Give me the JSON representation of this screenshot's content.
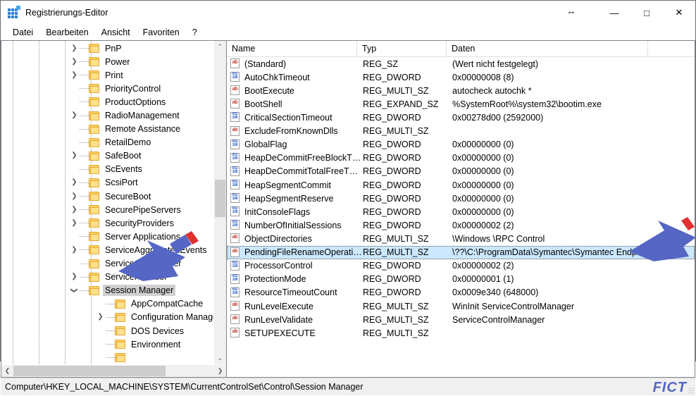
{
  "window": {
    "title": "Registrierungs-Editor",
    "icon": "registry-editor-icon",
    "controls": {
      "minimize": "—",
      "maximize": "□",
      "close": "✕",
      "resize_cursor": "↔"
    }
  },
  "menu": {
    "items": [
      "Datei",
      "Bearbeiten",
      "Ansicht",
      "Favoriten",
      "?"
    ]
  },
  "tree": {
    "selected": "Session Manager",
    "items": [
      {
        "label": "PnP",
        "depth": 3,
        "expander": "collapsed"
      },
      {
        "label": "Power",
        "depth": 3,
        "expander": "collapsed"
      },
      {
        "label": "Print",
        "depth": 3,
        "expander": "collapsed"
      },
      {
        "label": "PriorityControl",
        "depth": 3,
        "expander": "none"
      },
      {
        "label": "ProductOptions",
        "depth": 3,
        "expander": "none"
      },
      {
        "label": "RadioManagement",
        "depth": 3,
        "expander": "collapsed"
      },
      {
        "label": "Remote Assistance",
        "depth": 3,
        "expander": "none"
      },
      {
        "label": "RetailDemo",
        "depth": 3,
        "expander": "none"
      },
      {
        "label": "SafeBoot",
        "depth": 3,
        "expander": "collapsed"
      },
      {
        "label": "ScEvents",
        "depth": 3,
        "expander": "none"
      },
      {
        "label": "ScsiPort",
        "depth": 3,
        "expander": "collapsed"
      },
      {
        "label": "SecureBoot",
        "depth": 3,
        "expander": "collapsed"
      },
      {
        "label": "SecurePipeServers",
        "depth": 3,
        "expander": "collapsed"
      },
      {
        "label": "SecurityProviders",
        "depth": 3,
        "expander": "collapsed"
      },
      {
        "label": "Server Applications",
        "depth": 3,
        "expander": "none"
      },
      {
        "label": "ServiceAggregatedEvents",
        "depth": 3,
        "expander": "collapsed"
      },
      {
        "label": "ServiceGroupOrder",
        "depth": 3,
        "expander": "none"
      },
      {
        "label": "ServiceProvider",
        "depth": 3,
        "expander": "collapsed"
      },
      {
        "label": "Session Manager",
        "depth": 3,
        "expander": "expanded",
        "selected": true
      },
      {
        "label": "AppCompatCache",
        "depth": 4,
        "expander": "none"
      },
      {
        "label": "Configuration Manager",
        "depth": 4,
        "expander": "collapsed"
      },
      {
        "label": "DOS Devices",
        "depth": 4,
        "expander": "none"
      },
      {
        "label": "Environment",
        "depth": 4,
        "expander": "none"
      },
      {
        "label": "",
        "depth": 4,
        "expander": "none"
      }
    ]
  },
  "list": {
    "columns": [
      "Name",
      "Typ",
      "Daten"
    ],
    "selected_row": "PendingFileRenameOperations",
    "rows": [
      {
        "name": "(Standard)",
        "type": "REG_SZ",
        "data": "(Wert nicht festgelegt)",
        "icon": "string-value-icon"
      },
      {
        "name": "AutoChkTimeout",
        "type": "REG_DWORD",
        "data": "0x00000008 (8)",
        "icon": "dword-value-icon"
      },
      {
        "name": "BootExecute",
        "type": "REG_MULTI_SZ",
        "data": "autocheck autochk *",
        "icon": "string-value-icon"
      },
      {
        "name": "BootShell",
        "type": "REG_EXPAND_SZ",
        "data": "%SystemRoot%\\system32\\bootim.exe",
        "icon": "string-value-icon"
      },
      {
        "name": "CriticalSectionTimeout",
        "type": "REG_DWORD",
        "data": "0x00278d00 (2592000)",
        "icon": "dword-value-icon"
      },
      {
        "name": "ExcludeFromKnownDlls",
        "type": "REG_MULTI_SZ",
        "data": "",
        "icon": "string-value-icon"
      },
      {
        "name": "GlobalFlag",
        "type": "REG_DWORD",
        "data": "0x00000000 (0)",
        "icon": "dword-value-icon"
      },
      {
        "name": "HeapDeCommitFreeBlockThr...",
        "type": "REG_DWORD",
        "data": "0x00000000 (0)",
        "icon": "dword-value-icon"
      },
      {
        "name": "HeapDeCommitTotalFreeThr...",
        "type": "REG_DWORD",
        "data": "0x00000000 (0)",
        "icon": "dword-value-icon"
      },
      {
        "name": "HeapSegmentCommit",
        "type": "REG_DWORD",
        "data": "0x00000000 (0)",
        "icon": "dword-value-icon"
      },
      {
        "name": "HeapSegmentReserve",
        "type": "REG_DWORD",
        "data": "0x00000000 (0)",
        "icon": "dword-value-icon"
      },
      {
        "name": "InitConsoleFlags",
        "type": "REG_DWORD",
        "data": "0x00000000 (0)",
        "icon": "dword-value-icon"
      },
      {
        "name": "NumberOfInitialSessions",
        "type": "REG_DWORD",
        "data": "0x00000002 (2)",
        "icon": "dword-value-icon"
      },
      {
        "name": "ObjectDirectories",
        "type": "REG_MULTI_SZ",
        "data": "\\Windows \\RPC Control",
        "icon": "string-value-icon"
      },
      {
        "name": "PendingFileRenameOperations",
        "type": "REG_MULTI_SZ",
        "data": "\\??\\C:\\ProgramData\\Symantec\\Symantec Endpoi...",
        "icon": "string-value-icon",
        "selected": true
      },
      {
        "name": "ProcessorControl",
        "type": "REG_DWORD",
        "data": "0x00000002 (2)",
        "icon": "dword-value-icon"
      },
      {
        "name": "ProtectionMode",
        "type": "REG_DWORD",
        "data": "0x00000001 (1)",
        "icon": "dword-value-icon"
      },
      {
        "name": "ResourceTimeoutCount",
        "type": "REG_DWORD",
        "data": "0x0009e340 (648000)",
        "icon": "dword-value-icon"
      },
      {
        "name": "RunLevelExecute",
        "type": "REG_MULTI_SZ",
        "data": "WinInit ServiceControlManager",
        "icon": "string-value-icon"
      },
      {
        "name": "RunLevelValidate",
        "type": "REG_MULTI_SZ",
        "data": "ServiceControlManager",
        "icon": "string-value-icon"
      },
      {
        "name": "SETUPEXECUTE",
        "type": "REG_MULTI_SZ",
        "data": "",
        "icon": "string-value-icon"
      }
    ]
  },
  "statusbar": {
    "path": "Computer\\HKEY_LOCAL_MACHINE\\SYSTEM\\CurrentControlSet\\Control\\Session Manager",
    "watermark": "FICT"
  },
  "annotations": {
    "arrows": [
      {
        "name": "arrow-to-session-manager",
        "color": "#5566c4",
        "tail_color": "#e03030"
      },
      {
        "name": "arrow-to-pending-file-rename",
        "color": "#5566c4",
        "tail_color": "#e03030"
      }
    ]
  },
  "scrollbars": {
    "tree_vertical": {
      "up": "⌃",
      "down": "⌄"
    },
    "tree_horizontal": {
      "left": "❮",
      "right": "❯"
    }
  }
}
